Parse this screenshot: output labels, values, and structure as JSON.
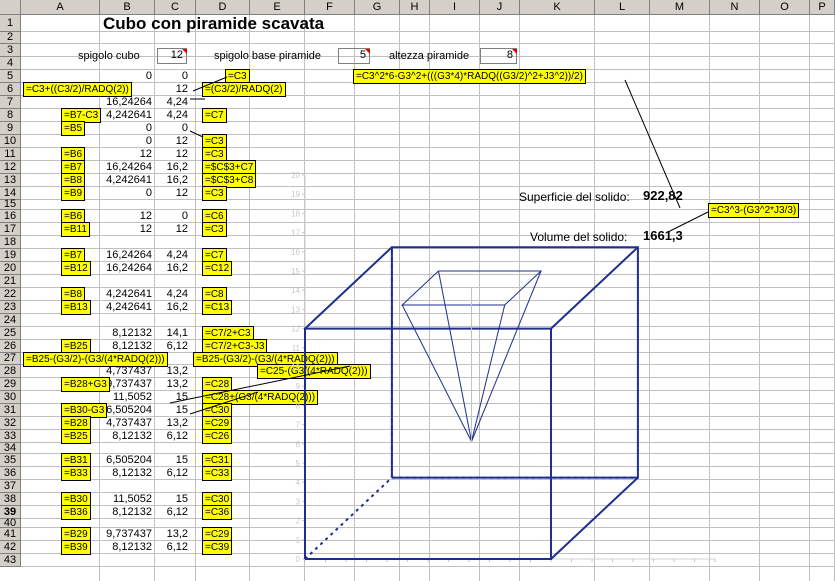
{
  "columns": [
    "A",
    "B",
    "C",
    "D",
    "E",
    "F",
    "G",
    "H",
    "I",
    "J",
    "K",
    "L",
    "M",
    "N",
    "O",
    "P"
  ],
  "rows": [
    "1",
    "2",
    "3",
    "4",
    "5",
    "6",
    "7",
    "8",
    "9",
    "10",
    "11",
    "12",
    "13",
    "14",
    "15",
    "16",
    "17",
    "18",
    "19",
    "20",
    "21",
    "22",
    "23",
    "24",
    "25",
    "26",
    "27",
    "28",
    "29",
    "30",
    "31",
    "32",
    "33",
    "34",
    "35",
    "36",
    "37",
    "38",
    "39",
    "40",
    "41",
    "42",
    "43"
  ],
  "selected_row": "39",
  "title": "Cubo con piramide scavata",
  "inputs": {
    "cube_edge_label": "spigolo cubo",
    "cube_edge_value": "12",
    "pyramid_base_label": "spigolo base piramide",
    "pyramid_base_value": "5",
    "pyramid_height_label": "altezza piramide",
    "pyramid_height_value": "8"
  },
  "results": {
    "surface_label": "Superficie del solido:",
    "surface_value": "922,82",
    "volume_label": "Volume del solido:",
    "volume_value": "1661,3"
  },
  "formulas": {
    "surface": "=C3^2*6-G3^2+(((G3*4)*RADQ((G3/2)^2+J3^2))/2)",
    "volume": "=C3^3-(G3^2*J3/3)"
  },
  "table": [
    {
      "row": "5",
      "b": "0",
      "c": "0"
    },
    {
      "row": "6",
      "b": "",
      "c": "12"
    },
    {
      "row": "7",
      "b": "16,24264",
      "c": "4,24"
    },
    {
      "row": "8",
      "b": "4,242641",
      "c": "4,24"
    },
    {
      "row": "9",
      "b": "0",
      "c": "0"
    },
    {
      "row": "10",
      "b": "0",
      "c": "12"
    },
    {
      "row": "11",
      "b": "12",
      "c": "12"
    },
    {
      "row": "12",
      "b": "16,24264",
      "c": "16,2"
    },
    {
      "row": "13",
      "b": "4,242641",
      "c": "16,2"
    },
    {
      "row": "14",
      "b": "0",
      "c": "12"
    },
    {
      "row": "16",
      "b": "12",
      "c": "0"
    },
    {
      "row": "17",
      "b": "12",
      "c": "12"
    },
    {
      "row": "19",
      "b": "16,24264",
      "c": "4,24"
    },
    {
      "row": "20",
      "b": "16,24264",
      "c": "16,2"
    },
    {
      "row": "22",
      "b": "4,242641",
      "c": "4,24"
    },
    {
      "row": "23",
      "b": "4,242641",
      "c": "16,2"
    },
    {
      "row": "25",
      "b": "8,12132",
      "c": "14,1"
    },
    {
      "row": "26",
      "b": "8,12132",
      "c": "6,12"
    },
    {
      "row": "28",
      "b": "4,737437",
      "c": "13,2"
    },
    {
      "row": "29",
      "b": "9,737437",
      "c": "13,2"
    },
    {
      "row": "30",
      "b": "11,5052",
      "c": "15"
    },
    {
      "row": "31",
      "b": "6,505204",
      "c": "15"
    },
    {
      "row": "32",
      "b": "4,737437",
      "c": "13,2"
    },
    {
      "row": "33",
      "b": "8,12132",
      "c": "6,12"
    },
    {
      "row": "35",
      "b": "6,505204",
      "c": "15"
    },
    {
      "row": "36",
      "b": "8,12132",
      "c": "6,12"
    },
    {
      "row": "38",
      "b": "11,5052",
      "c": "15"
    },
    {
      "row": "39",
      "b": "8,12132",
      "c": "6,12"
    },
    {
      "row": "41",
      "b": "9,737437",
      "c": "13,2"
    },
    {
      "row": "42",
      "b": "8,12132",
      "c": "6,12"
    }
  ],
  "callouts_a": [
    {
      "row": "6",
      "text": "=C3+((C3/2)/RADQ(2))"
    },
    {
      "row": "8",
      "text": "=B7-C3"
    },
    {
      "row": "9",
      "text": "=B5"
    },
    {
      "row": "11",
      "text": "=B6"
    },
    {
      "row": "12",
      "text": "=B7"
    },
    {
      "row": "13",
      "text": "=B8"
    },
    {
      "row": "14",
      "text": "=B9"
    },
    {
      "row": "16",
      "text": "=B6"
    },
    {
      "row": "17",
      "text": "=B11"
    },
    {
      "row": "19",
      "text": "=B7"
    },
    {
      "row": "20",
      "text": "=B12"
    },
    {
      "row": "22",
      "text": "=B8"
    },
    {
      "row": "23",
      "text": "=B13"
    },
    {
      "row": "26",
      "text": "=B25"
    },
    {
      "row": "27",
      "text": "=B25-(G3/2)-(G3/(4*RADQ(2)))"
    },
    {
      "row": "29",
      "text": "=B28+G3"
    },
    {
      "row": "31",
      "text": "=B30-G3"
    },
    {
      "row": "32",
      "text": "=B28"
    },
    {
      "row": "33",
      "text": "=B25"
    },
    {
      "row": "35",
      "text": "=B31"
    },
    {
      "row": "36",
      "text": "=B33"
    },
    {
      "row": "38",
      "text": "=B30"
    },
    {
      "row": "39",
      "text": "=B36"
    },
    {
      "row": "41",
      "text": "=B29"
    },
    {
      "row": "42",
      "text": "=B39"
    }
  ],
  "callouts_d": [
    {
      "row": "5",
      "text": "=C3"
    },
    {
      "row": "6",
      "text": "=(C3/2)/RADQ(2)"
    },
    {
      "row": "8",
      "text": "=C7"
    },
    {
      "row": "10",
      "text": "=C3"
    },
    {
      "row": "11",
      "text": "=C3"
    },
    {
      "row": "12",
      "text": "=$C$3+C7"
    },
    {
      "row": "13",
      "text": "=$C$3+C8"
    },
    {
      "row": "14",
      "text": "=C3"
    },
    {
      "row": "16",
      "text": "=C6"
    },
    {
      "row": "17",
      "text": "=C3"
    },
    {
      "row": "19",
      "text": "=C7"
    },
    {
      "row": "20",
      "text": "=C12"
    },
    {
      "row": "22",
      "text": "=C8"
    },
    {
      "row": "23",
      "text": "=C13"
    },
    {
      "row": "25",
      "text": "=C7/2+C3"
    },
    {
      "row": "26",
      "text": "=C7/2+C3-J3"
    },
    {
      "row": "27",
      "text": "=B25-(G3/2)-(G3/(4*RADQ(2)))"
    },
    {
      "row": "28",
      "text": "=C25-(G3/(4*RADQ(2)))"
    },
    {
      "row": "29",
      "text": "=C28"
    },
    {
      "row": "30",
      "text": "=C28+(G3/(4*RADQ(2)))"
    },
    {
      "row": "31",
      "text": "=C30"
    },
    {
      "row": "32",
      "text": "=C29"
    },
    {
      "row": "33",
      "text": "=C26"
    },
    {
      "row": "35",
      "text": "=C31"
    },
    {
      "row": "36",
      "text": "=C33"
    },
    {
      "row": "38",
      "text": "=C30"
    },
    {
      "row": "39",
      "text": "=C36"
    },
    {
      "row": "41",
      "text": "=C29"
    },
    {
      "row": "42",
      "text": "=C39"
    }
  ],
  "chart_data": {
    "type": "line",
    "ylim": [
      0,
      20
    ],
    "xlim": [
      0,
      20
    ],
    "yticks": [
      "0",
      "1",
      "2",
      "3",
      "4",
      "5",
      "6",
      "7",
      "8",
      "9",
      "10",
      "11",
      "12",
      "13",
      "14",
      "15",
      "16",
      "17",
      "18",
      "19",
      "20"
    ],
    "series": [
      {
        "points": [
          [
            0,
            0
          ],
          [
            12,
            0
          ],
          [
            12,
            12
          ],
          [
            0,
            12
          ],
          [
            0,
            0
          ]
        ]
      },
      {
        "points": [
          [
            4.24,
            4.24
          ],
          [
            16.24,
            4.24
          ],
          [
            16.24,
            16.24
          ],
          [
            4.24,
            16.24
          ],
          [
            4.24,
            4.24
          ]
        ]
      },
      {
        "points": [
          [
            0,
            12
          ],
          [
            4.24,
            16.24
          ]
        ]
      },
      {
        "points": [
          [
            12,
            12
          ],
          [
            16.24,
            16.24
          ]
        ]
      },
      {
        "points": [
          [
            12,
            0
          ],
          [
            16.24,
            4.24
          ]
        ]
      },
      {
        "points": [
          [
            0,
            0
          ],
          [
            4.24,
            4.24
          ]
        ],
        "dashed": true
      },
      {
        "points": [
          [
            4.24,
            4.24
          ],
          [
            16.24,
            4.24
          ]
        ],
        "dashed": true
      },
      {
        "points": [
          [
            4.24,
            4.24
          ],
          [
            4.24,
            16.24
          ]
        ],
        "dashed": true
      },
      {
        "points": [
          [
            6.51,
            15
          ],
          [
            11.51,
            15
          ],
          [
            9.74,
            13.23
          ],
          [
            4.74,
            13.23
          ],
          [
            6.51,
            15
          ]
        ]
      },
      {
        "points": [
          [
            8.12,
            6.12
          ],
          [
            4.74,
            13.23
          ]
        ]
      },
      {
        "points": [
          [
            8.12,
            6.12
          ],
          [
            9.74,
            13.23
          ]
        ]
      },
      {
        "points": [
          [
            8.12,
            6.12
          ],
          [
            11.51,
            15
          ]
        ]
      },
      {
        "points": [
          [
            8.12,
            6.12
          ],
          [
            6.51,
            15
          ]
        ]
      },
      {
        "points": [
          [
            8.12,
            6.12
          ],
          [
            8.12,
            14.1
          ]
        ],
        "faint": true
      }
    ]
  }
}
